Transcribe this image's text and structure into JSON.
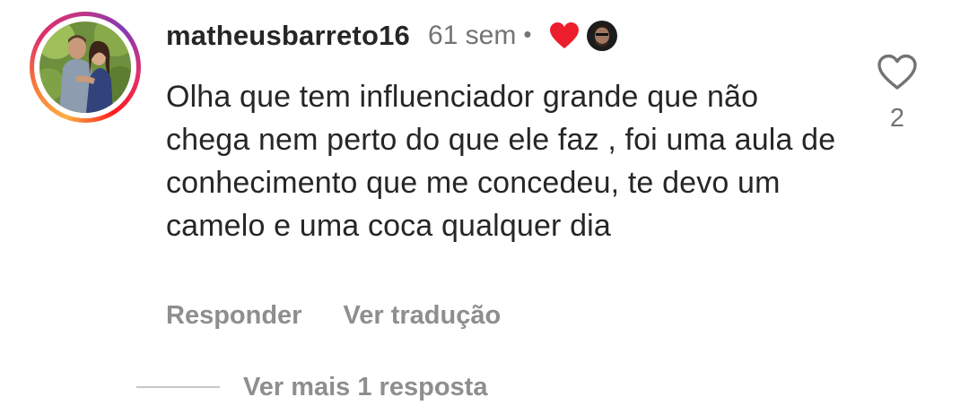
{
  "comment": {
    "username": "matheusbarreto16",
    "time": "61 sem",
    "separator": "•",
    "text": "Olha que tem influenciador grande que não chega nem perto do que ele faz , foi uma aula de conhecimento que me concedeu, te devo um camelo e uma coca qualquer dia",
    "liked_by_author_icon": "heart-filled-icon",
    "liked_by_author_color": "#ed1d2c",
    "like_count": "2",
    "like_icon": "heart-outline-icon"
  },
  "actions": {
    "reply_label": "Responder",
    "translate_label": "Ver tradução"
  },
  "replies": {
    "view_more_label": "Ver mais 1 resposta"
  },
  "colors": {
    "text_primary": "#262626",
    "text_secondary": "#737373",
    "action_text": "#8e8e8e"
  }
}
